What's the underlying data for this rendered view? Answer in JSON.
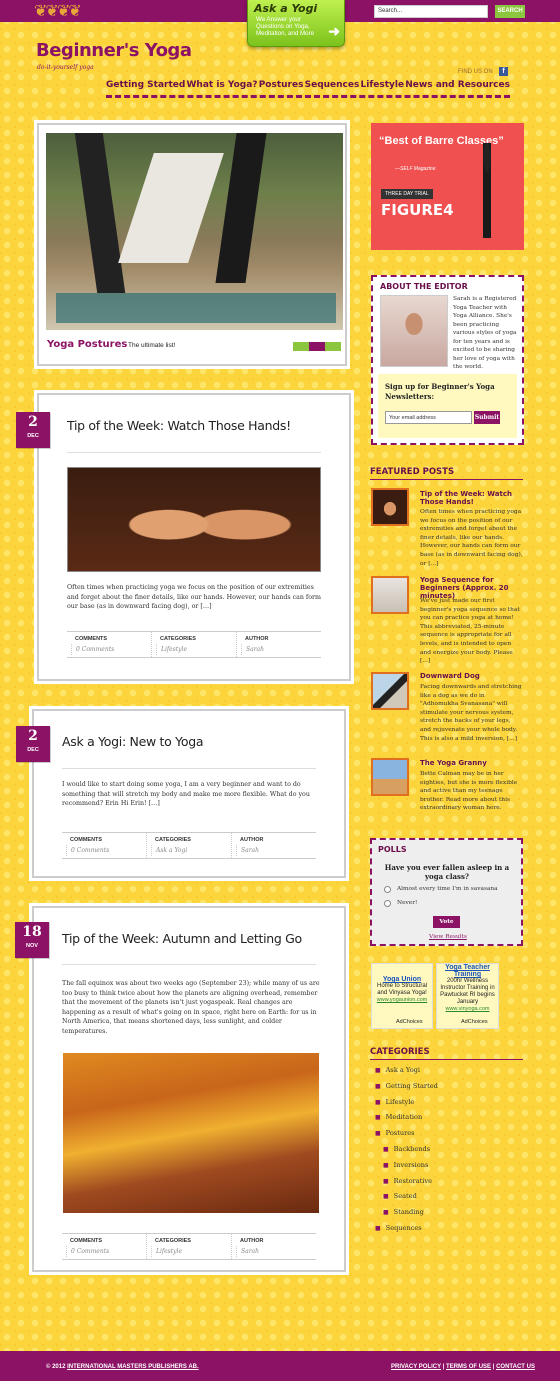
{
  "header": {
    "ask": {
      "title": "Ask a Yogi",
      "desc": "We Answer your Questions on Yoga, Meditation, and More"
    },
    "search": {
      "placeholder": "Search...",
      "button": "SEARCH"
    },
    "logo": "Beginner's Yoga",
    "tagline": "do-it-yourself yoga",
    "find_us": "FIND US ON",
    "fb": "f",
    "nav": [
      "Getting Started",
      "What is Yoga?",
      "Postures",
      "Sequences",
      "Lifestyle",
      "News and Resources"
    ]
  },
  "featured": {
    "title": "Yoga Postures",
    "sub": "The ultimate list!",
    "dot_colors": [
      "#8cc63f",
      "#8b1264",
      "#8cc63f"
    ]
  },
  "posts": [
    {
      "day": "2",
      "month": "DEC",
      "title": "Tip of the Week: Watch Those Hands!",
      "body": "Often times when practicing yoga we focus on the position of our extremities and forget about the finer details, like our hands.  However, our hands can form our base (as in downward facing dog), or […]",
      "meta": {
        "comments_h": "COMMENTS",
        "comments": "0 Comments",
        "categories_h": "CATEGORIES",
        "categories": "Lifestyle",
        "author_h": "AUTHOR",
        "author": "Sarah"
      }
    },
    {
      "day": "2",
      "month": "DEC",
      "title": "Ask a Yogi: New to Yoga",
      "body": "I would like to start doing some yoga, I am a very beginner and want to do something that will stretch my body and make me more flexible. What do you recommend? Erin Hi Erin! […]",
      "meta": {
        "comments_h": "COMMENTS",
        "comments": "0 Comments",
        "categories_h": "CATEGORIES",
        "categories": "Ask a Yogi",
        "author_h": "AUTHOR",
        "author": "Sarah"
      }
    },
    {
      "day": "18",
      "month": "NOV",
      "title": "Tip of the Week: Autumn and Letting Go",
      "body": "The fall equinox was about two weeks ago (September 23); while many of us are too busy to think twice about how the planets are aligning overhead, remember that the movement of the planets isn't just yogaspeak. Real changes are happening as a result of what's going on in space, right here on Earth: for us in North America, that means shortened days, less sunlight, and colder temperatures.",
      "meta": {
        "comments_h": "COMMENTS",
        "comments": "0 Comments",
        "categories_h": "CATEGORIES",
        "categories": "Lifestyle",
        "author_h": "AUTHOR",
        "author": "Sarah"
      }
    }
  ],
  "ad": {
    "quote": "“Best of Barre Classes”",
    "source": "—SELF Magazine",
    "trial": "THREE DAY TRIAL",
    "brand": "FIGURE4"
  },
  "editor": {
    "heading": "ABOUT THE EDITOR",
    "text": "Sarah is a Registered Yoga Teacher with Yoga Alliance. She's been practicing various styles of yoga for ten years and is excited to be sharing her love of yoga with the world.",
    "signup": "Sign up for Beginner's Yoga Newsletters:",
    "email_placeholder": "Your email address",
    "submit": "Submit"
  },
  "featured_posts": {
    "heading": "FEATURED POSTS",
    "items": [
      {
        "title": "Tip of the Week: Watch Those Hands!",
        "text": "Often times when practicing yoga we focus on the position of our extremities and forget about the finer details, like our hands.  However, our hands can form our base (as in downward facing dog), or [...]"
      },
      {
        "title": "Yoga Sequence for Beginners (Approx. 20 minutes)",
        "text": "We've just made our first beginner's yoga sequence so that you can practice yoga at home! This abbreviated, 25-minute sequence is appropriate for all levels, and is intended to open and energize your body. Please [...]"
      },
      {
        "title": "Downward Dog",
        "text": "Facing downwards and stretching like a dog as we do in \"Adhomukha Svanasana\" will stimulate your nervous system, stretch the backs of your legs, and rejuvenate your whole body. This is also a mild inversion, [...]"
      },
      {
        "title": "The Yoga Granny",
        "text": "Bette Calman may be in her eighties, but she is more flexible and active than my  teenage brother. Read more about this extraordinary woman here."
      }
    ]
  },
  "poll": {
    "heading": "POLLS",
    "question": "Have you ever fallen asleep in a yoga class?",
    "options": [
      "Almost every time I'm in savasana",
      "Never!"
    ],
    "vote": "Vote",
    "results": "View Results"
  },
  "gads": [
    {
      "title": "Yoga Union",
      "body": "Home to Structural and Vinyasa Yoga!",
      "url": "www.yogaunion.com",
      "choices": "AdChoices"
    },
    {
      "title": "Yoga Teacher Training",
      "body": "200hr Wellness Instructor Training in Pawtucket RI begins January",
      "url": "www.vinyoga.com",
      "choices": "AdChoices"
    }
  ],
  "categories": {
    "heading": "CATEGORIES",
    "items": [
      "Ask a Yogi",
      "Getting Started",
      "Lifestyle",
      "Meditation",
      "Postures"
    ],
    "sub": [
      "Backbends",
      "Inversions",
      "Restorative",
      "Seated",
      "Standing"
    ],
    "last": "Sequences"
  },
  "footer": {
    "copyright": "© 2012",
    "company": "INTERNATIONAL MASTERS PUBLISHERS AB.",
    "privacy": "PRIVACY POLICY",
    "terms": "TERMS OF USE",
    "contact": "CONTACT US"
  }
}
